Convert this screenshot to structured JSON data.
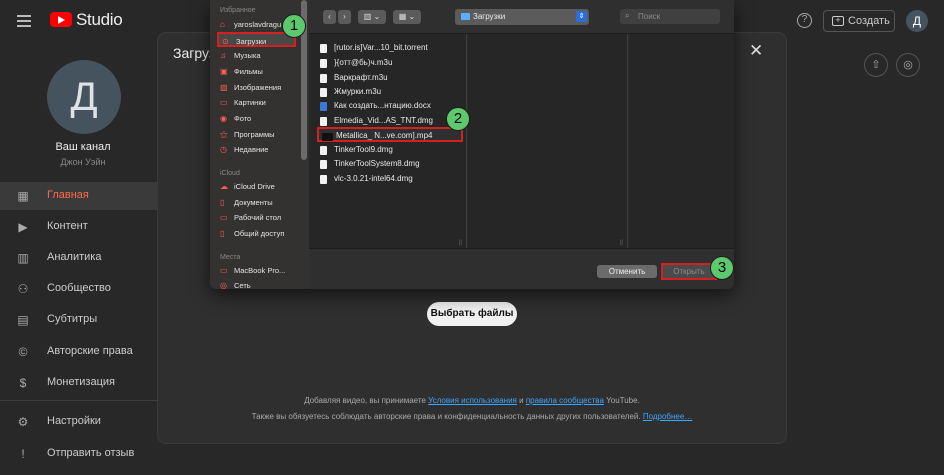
{
  "app": {
    "logo_text": "Studio",
    "create_label": "Создать",
    "avatar_letter": "Д"
  },
  "sidebar": {
    "avatar_letter": "Д",
    "channel_label": "Ваш канал",
    "channel_name": "Джон Уэйн",
    "items": [
      {
        "label": "Главная",
        "icon": "dashboard-icon",
        "glyph": "▦",
        "active": true
      },
      {
        "label": "Контент",
        "icon": "content-icon",
        "glyph": "▶"
      },
      {
        "label": "Аналитика",
        "icon": "analytics-icon",
        "glyph": "▥"
      },
      {
        "label": "Сообщество",
        "icon": "community-icon",
        "glyph": "⚇"
      },
      {
        "label": "Субтитры",
        "icon": "subtitles-icon",
        "glyph": "▤"
      },
      {
        "label": "Авторские права",
        "icon": "copyright-icon",
        "glyph": "©"
      },
      {
        "label": "Монетизация",
        "icon": "monetization-icon",
        "glyph": "$"
      },
      {
        "label": "Настройки",
        "icon": "settings-icon",
        "glyph": "⚙"
      },
      {
        "label": "Отправить отзыв",
        "icon": "feedback-icon",
        "glyph": "!"
      }
    ]
  },
  "upload_dialog": {
    "title": "Загрузка видео",
    "select_files": "Выбрать файлы",
    "terms_prefix": "Добавляя видео, вы принимаете",
    "terms_link": "Условия использования",
    "terms_and": "и",
    "community_link": "правила сообщества",
    "terms_suffix": "YouTube.",
    "rights_text": "Также вы обязуетесь соблюдать авторские права и конфиденциальность данных других пользователей.",
    "more_link": "Подробнее…"
  },
  "finder": {
    "favorites_header": "Избранное",
    "favorites": [
      {
        "label": "yaroslavdragu",
        "icon": "home-icon",
        "glyph": "⌂"
      },
      {
        "label": "Загрузки",
        "icon": "downloads-icon",
        "glyph": "⊙",
        "selected": true
      },
      {
        "label": "Музыка",
        "icon": "music-icon",
        "glyph": "♫"
      },
      {
        "label": "Фильмы",
        "icon": "movies-icon",
        "glyph": "▣"
      },
      {
        "label": "Изображения",
        "icon": "pictures-icon",
        "glyph": "▨"
      },
      {
        "label": "Картинки",
        "icon": "images-icon",
        "glyph": "▭"
      },
      {
        "label": "Фото",
        "icon": "photo-icon",
        "glyph": "◉"
      },
      {
        "label": "Программы",
        "icon": "applications-icon",
        "glyph": "⚝"
      },
      {
        "label": "Недавние",
        "icon": "recents-icon",
        "glyph": "◷"
      }
    ],
    "icloud_header": "iCloud",
    "icloud": [
      {
        "label": "iCloud Drive",
        "icon": "cloud-icon",
        "glyph": "☁"
      },
      {
        "label": "Документы",
        "icon": "documents-icon",
        "glyph": "▯"
      },
      {
        "label": "Рабочий стол",
        "icon": "desktop-icon",
        "glyph": "▭"
      },
      {
        "label": "Общий доступ",
        "icon": "shared-icon",
        "glyph": "▯"
      }
    ],
    "places_header": "Места",
    "places": [
      {
        "label": "MacBook Pro...",
        "icon": "laptop-icon",
        "glyph": "▭"
      },
      {
        "label": "Сеть",
        "icon": "network-icon",
        "glyph": "◎"
      }
    ],
    "current_folder": "Загрузки",
    "search_placeholder": "Поиск",
    "files": [
      {
        "name": "[rutor.is]Var...10_bit.torrent",
        "kind": "file"
      },
      {
        "name": "}{отт@бь)ч.m3u",
        "kind": "file"
      },
      {
        "name": "Варкрафт.m3u",
        "kind": "file"
      },
      {
        "name": "Жмурки.m3u",
        "kind": "file"
      },
      {
        "name": "Как создать...нтацию.docx",
        "kind": "doc"
      },
      {
        "name": "Elmedia_Vid...AS_TNT.dmg",
        "kind": "file"
      },
      {
        "name": "Metallica_ N...ve.com].mp4",
        "kind": "vid",
        "selected": true
      },
      {
        "name": "TinkerTool9.dmg",
        "kind": "file"
      },
      {
        "name": "TinkerToolSystem8.dmg",
        "kind": "file"
      },
      {
        "name": "vlc-3.0.21-intel64.dmg",
        "kind": "file"
      }
    ],
    "cancel_label": "Отменить",
    "open_label": "Открыть"
  },
  "steps": [
    "1",
    "2",
    "3"
  ],
  "colors": {
    "accent_red": "#d42020",
    "step_green": "#5dc96d",
    "active_nav": "#ff6a4d",
    "link_blue": "#3ea6ff"
  }
}
